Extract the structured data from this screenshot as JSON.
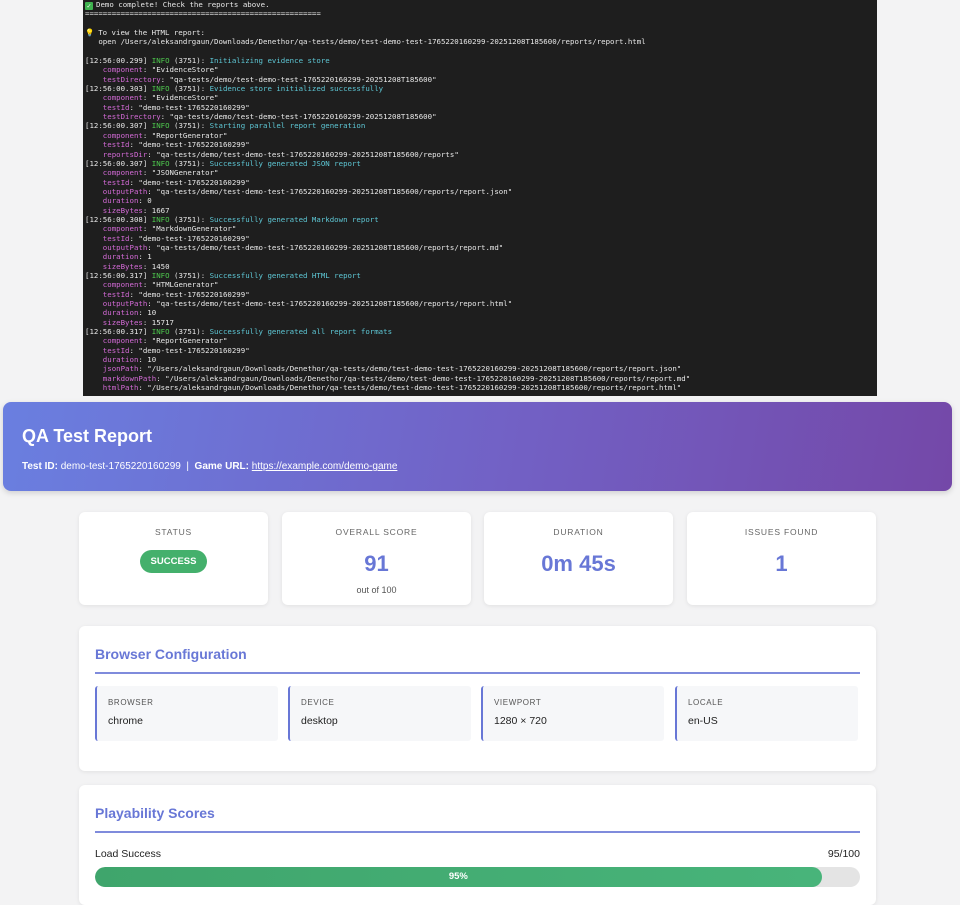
{
  "terminal": {
    "demo_complete": "Demo complete! Check the reports above.",
    "separator": "=====================================================",
    "view_hint": "To view the HTML report:",
    "open_cmd": "   open /Users/aleksandrgaun/Downloads/Denethor/qa-tests/demo/test-demo-test-1765220160299-20251208T185600/reports/report.html",
    "logs": [
      {
        "ts": "[12:56:00.299]",
        "lvl": "INFO",
        "pid": " (3751): ",
        "msg": "Initializing evidence store",
        "fields": [
          [
            "component",
            "\"EvidenceStore\""
          ],
          [
            "testDirectory",
            "\"qa-tests/demo/test-demo-test-1765220160299-20251208T185600\""
          ]
        ]
      },
      {
        "ts": "[12:56:00.303]",
        "lvl": "INFO",
        "pid": " (3751): ",
        "msg": "Evidence store initialized successfully",
        "fields": [
          [
            "component",
            "\"EvidenceStore\""
          ],
          [
            "testId",
            "\"demo-test-1765220160299\""
          ],
          [
            "testDirectory",
            "\"qa-tests/demo/test-demo-test-1765220160299-20251208T185600\""
          ]
        ]
      },
      {
        "ts": "[12:56:00.307]",
        "lvl": "INFO",
        "pid": " (3751): ",
        "msg": "Starting parallel report generation",
        "fields": [
          [
            "component",
            "\"ReportGenerator\""
          ],
          [
            "testId",
            "\"demo-test-1765220160299\""
          ],
          [
            "reportsDir",
            "\"qa-tests/demo/test-demo-test-1765220160299-20251208T185600/reports\""
          ]
        ]
      },
      {
        "ts": "[12:56:00.307]",
        "lvl": "INFO",
        "pid": " (3751): ",
        "msg": "Successfully generated JSON report",
        "fields": [
          [
            "component",
            "\"JSONGenerator\""
          ],
          [
            "testId",
            "\"demo-test-1765220160299\""
          ],
          [
            "outputPath",
            "\"qa-tests/demo/test-demo-test-1765220160299-20251208T185600/reports/report.json\""
          ],
          [
            "duration",
            "0"
          ],
          [
            "sizeBytes",
            "1667"
          ]
        ]
      },
      {
        "ts": "[12:56:00.308]",
        "lvl": "INFO",
        "pid": " (3751): ",
        "msg": "Successfully generated Markdown report",
        "fields": [
          [
            "component",
            "\"MarkdownGenerator\""
          ],
          [
            "testId",
            "\"demo-test-1765220160299\""
          ],
          [
            "outputPath",
            "\"qa-tests/demo/test-demo-test-1765220160299-20251208T185600/reports/report.md\""
          ],
          [
            "duration",
            "1"
          ],
          [
            "sizeBytes",
            "1450"
          ]
        ]
      },
      {
        "ts": "[12:56:00.317]",
        "lvl": "INFO",
        "pid": " (3751): ",
        "msg": "Successfully generated HTML report",
        "fields": [
          [
            "component",
            "\"HTMLGenerator\""
          ],
          [
            "testId",
            "\"demo-test-1765220160299\""
          ],
          [
            "outputPath",
            "\"qa-tests/demo/test-demo-test-1765220160299-20251208T185600/reports/report.html\""
          ],
          [
            "duration",
            "10"
          ],
          [
            "sizeBytes",
            "15717"
          ]
        ]
      },
      {
        "ts": "[12:56:00.317]",
        "lvl": "INFO",
        "pid": " (3751): ",
        "msg": "Successfully generated all report formats",
        "fields": [
          [
            "component",
            "\"ReportGenerator\""
          ],
          [
            "testId",
            "\"demo-test-1765220160299\""
          ],
          [
            "duration",
            "10"
          ],
          [
            "jsonPath",
            "\"/Users/aleksandrgaun/Downloads/Denethor/qa-tests/demo/test-demo-test-1765220160299-20251208T185600/reports/report.json\""
          ],
          [
            "markdownPath",
            "\"/Users/aleksandrgaun/Downloads/Denethor/qa-tests/demo/test-demo-test-1765220160299-20251208T185600/reports/report.md\""
          ],
          [
            "htmlPath",
            "\"/Users/aleksandrgaun/Downloads/Denethor/qa-tests/demo/test-demo-test-1765220160299-20251208T185600/reports/report.html\""
          ]
        ]
      }
    ]
  },
  "report": {
    "title": "QA Test Report",
    "test_id_label": "Test ID:",
    "test_id": "demo-test-1765220160299",
    "separator": "|",
    "game_url_label": "Game URL:",
    "game_url": "https://example.com/demo-game"
  },
  "stats": {
    "status_label": "STATUS",
    "status_value": "SUCCESS",
    "score_label": "OVERALL SCORE",
    "score_value": "91",
    "score_sub": "out of 100",
    "duration_label": "DURATION",
    "duration_value": "0m 45s",
    "issues_label": "ISSUES FOUND",
    "issues_value": "1"
  },
  "browser_config": {
    "title": "Browser Configuration",
    "items": [
      {
        "key": "BROWSER",
        "value": "chrome"
      },
      {
        "key": "DEVICE",
        "value": "desktop"
      },
      {
        "key": "VIEWPORT",
        "value": "1280 × 720"
      },
      {
        "key": "LOCALE",
        "value": "en-US"
      }
    ]
  },
  "playability": {
    "title": "Playability Scores",
    "rows": [
      {
        "label": "Load Success",
        "score": "95/100",
        "percent_text": "95%",
        "fraction": 0.95
      }
    ]
  },
  "colors": {
    "accent": "#6877d6",
    "success": "#44b06c",
    "terminal_bg": "#1e1e1e"
  }
}
